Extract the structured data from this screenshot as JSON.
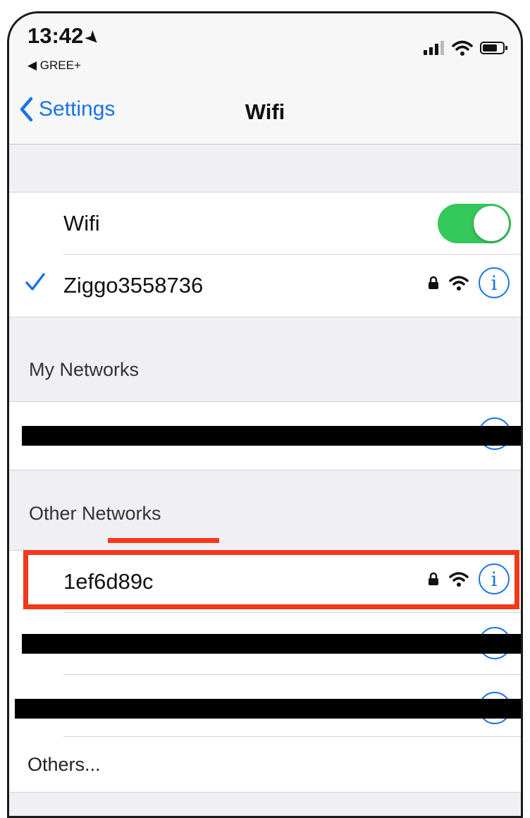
{
  "status_bar": {
    "time": "13:42",
    "back_app_label": "◀ GREE+"
  },
  "nav": {
    "back_label": "Settings",
    "title": "Wifi"
  },
  "wifi_toggle": {
    "label": "Wifi",
    "on": true,
    "color": "#34c759"
  },
  "connected_network": {
    "name": "Ziggo3558736",
    "secured": true
  },
  "my_networks": {
    "header": "My Networks"
  },
  "other_networks": {
    "header": "Other Networks",
    "items": [
      {
        "name": "1ef6d89c",
        "secured": true
      }
    ]
  },
  "others_label": "Others...",
  "accent_color": "#1a73e8",
  "annotation_color": "#f23a1a"
}
